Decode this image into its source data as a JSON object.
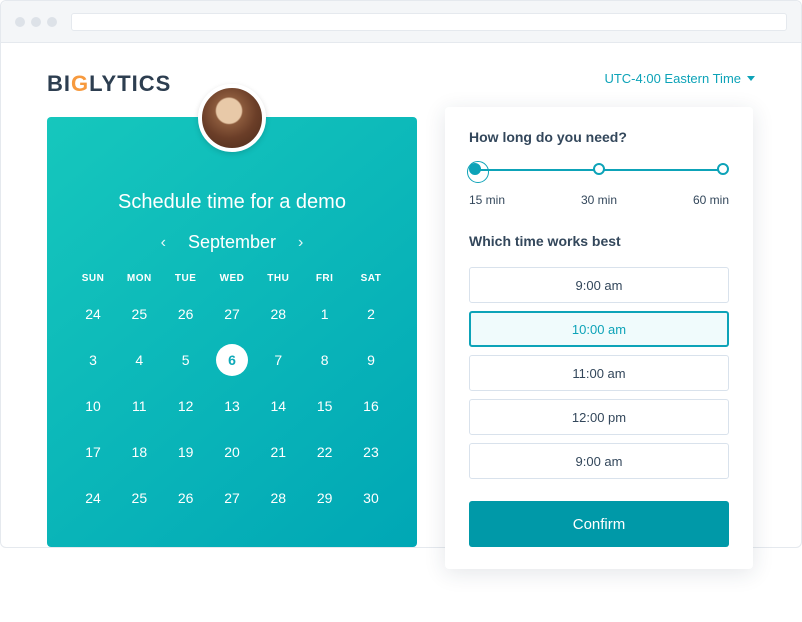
{
  "logo_parts": {
    "pre": "BI",
    "g": "G",
    "post": "LYTICS"
  },
  "timezone": "UTC-4:00 Eastern Time",
  "calendar": {
    "title": "Schedule time for a demo",
    "month": "September",
    "weekdays": [
      "SUN",
      "MON",
      "TUE",
      "WED",
      "THU",
      "FRI",
      "SAT"
    ],
    "rows": [
      [
        "24",
        "25",
        "26",
        "27",
        "28",
        "1",
        "2"
      ],
      [
        "3",
        "4",
        "5",
        "6",
        "7",
        "8",
        "9"
      ],
      [
        "10",
        "11",
        "12",
        "13",
        "14",
        "15",
        "16"
      ],
      [
        "17",
        "18",
        "19",
        "20",
        "21",
        "22",
        "23"
      ],
      [
        "24",
        "25",
        "26",
        "27",
        "28",
        "29",
        "30"
      ]
    ],
    "selected_day": "6"
  },
  "panel": {
    "duration_title": "How long do you need?",
    "durations": [
      "15 min",
      "30 min",
      "60 min"
    ],
    "selected_duration_index": 0,
    "time_title": "Which time works best",
    "slots": [
      "9:00 am",
      "10:00 am",
      "11:00 am",
      "12:00 pm",
      "9:00 am"
    ],
    "selected_slot_index": 1,
    "confirm_label": "Confirm"
  }
}
